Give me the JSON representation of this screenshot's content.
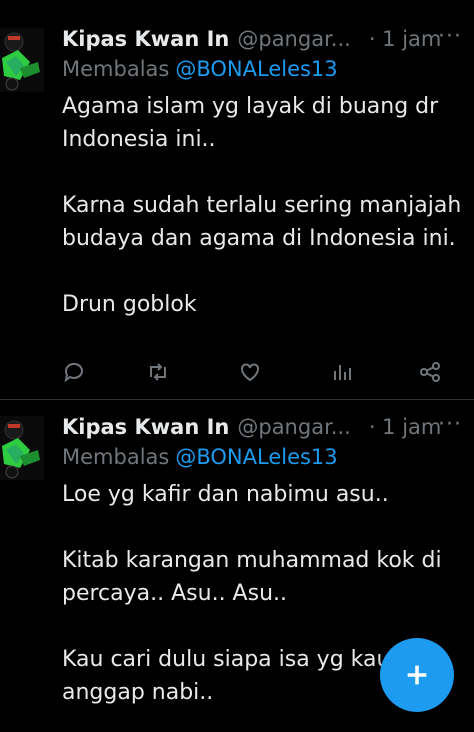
{
  "colors": {
    "background": "#000000",
    "text": "#e7e9ea",
    "muted": "#71767b",
    "accent": "#1d9bf0"
  },
  "tweets": [
    {
      "author_name": "Kipas Kwan In",
      "handle": "@pangar...",
      "time": "· 1 jam",
      "more": "···",
      "reply_prefix": "Membalas",
      "reply_mention": "@BONALeles13",
      "paragraphs": [
        "Agama islam yg layak di buang dr Indonesia ini..",
        "Karna sudah terlalu sering manjajah budaya dan agama di Indonesia ini.",
        "Drun goblok"
      ],
      "actions": [
        "reply-icon",
        "retweet-icon",
        "like-icon",
        "views-icon",
        "share-icon"
      ]
    },
    {
      "author_name": "Kipas Kwan In",
      "handle": "@pangar...",
      "time": "· 1 jam",
      "more": "···",
      "reply_prefix": "Membalas",
      "reply_mention": "@BONALeles13",
      "paragraphs": [
        "Loe yg kafir dan nabimu asu..",
        "Kitab karangan muhammad kok di percaya.. Asu.. Asu..",
        "Kau cari dulu siapa isa yg kau anggap nabi.."
      ]
    }
  ],
  "fab": {
    "icon": "plus-icon"
  }
}
